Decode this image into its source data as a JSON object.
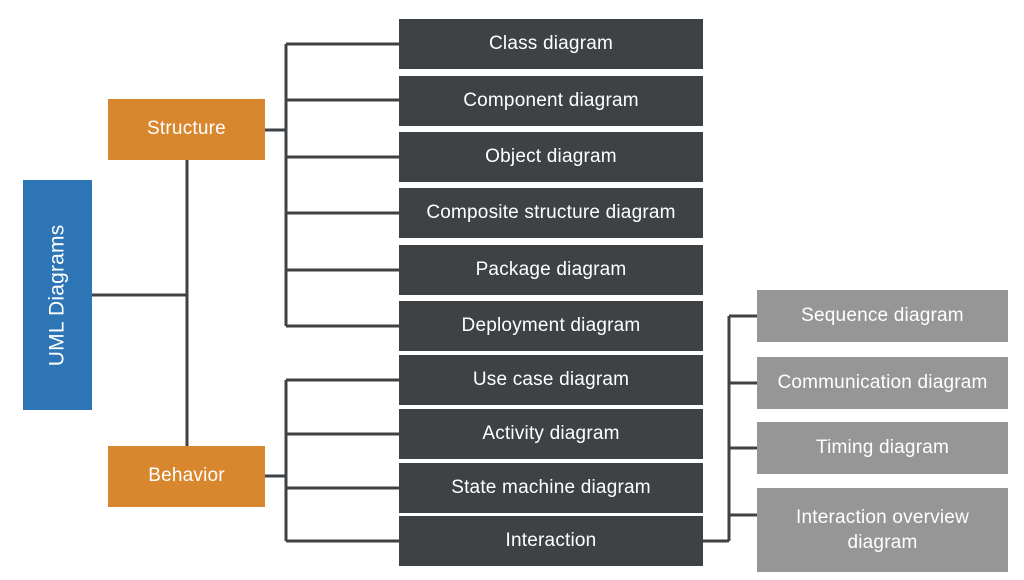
{
  "diagram": {
    "title": "UML Diagrams",
    "colors": {
      "root": "#2E75B6",
      "category": "#D9872F",
      "leaf": "#3E4245",
      "sub": "#969696",
      "connector": "#3E4245",
      "background": "#FFFFFF",
      "text": "#FFFFFF"
    },
    "root": {
      "label": "UML Diagrams",
      "orientation": "vertical"
    },
    "categories": [
      {
        "label": "Structure"
      },
      {
        "label": "Behavior"
      }
    ],
    "structure_children": [
      {
        "label": "Class diagram"
      },
      {
        "label": "Component diagram"
      },
      {
        "label": "Object diagram"
      },
      {
        "label": "Composite structure diagram"
      },
      {
        "label": "Package diagram"
      },
      {
        "label": "Deployment diagram"
      }
    ],
    "behavior_children": [
      {
        "label": "Use case diagram"
      },
      {
        "label": "Activity diagram"
      },
      {
        "label": "State machine diagram"
      },
      {
        "label": "Interaction"
      }
    ],
    "interaction_children": [
      {
        "label": "Sequence diagram"
      },
      {
        "label": "Communication diagram"
      },
      {
        "label": "Timing diagram"
      },
      {
        "label": "Interaction overview diagram"
      }
    ]
  }
}
